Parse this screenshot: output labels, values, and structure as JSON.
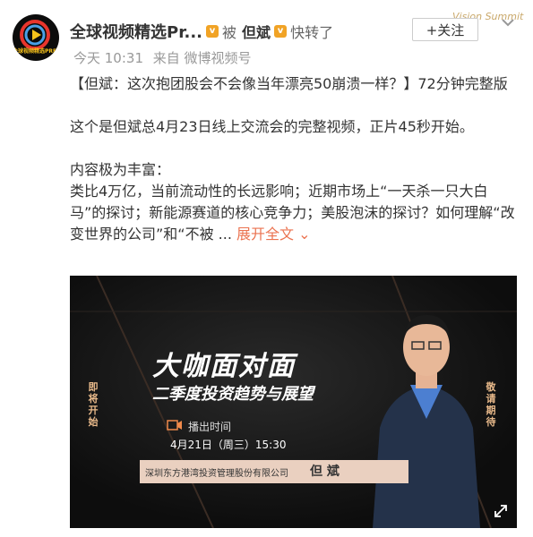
{
  "post": {
    "author": "全球视频精选Pr...",
    "forward_text": "被",
    "original_author": "但斌",
    "action": "快转了",
    "time": "今天 10:31",
    "source": "来自 微博视频号",
    "follow_label": "+关注",
    "watermark": "Vision Summit",
    "avatar_text": "全球视频精选PREMIUM"
  },
  "content": {
    "line1": "【但斌：这次抱团股会不会像当年漂亮50崩溃一样？】72分钟完整版",
    "line2": "这个是但斌总4月23日线上交流会的完整视频，正片45秒开始。",
    "line3": "内容极为丰富：",
    "line4": "类比4万亿，当前流动性的长远影响；近期市场上“一天杀一只大白马”的探讨；新能源赛道的核心竞争力；美股泡沫的探讨？如何理解“改变世界的公司”和“不被 ...",
    "expand": "展开全文"
  },
  "video": {
    "title": "大咖面对面",
    "subtitle": "二季度投资趋势与展望",
    "left_vertical": "即将开始",
    "right_vertical": "敬请期待",
    "play_label": "播出时间",
    "date": "4月21日（周三）15:30",
    "company": "深圳东方港湾投资管理股份有限公司",
    "speaker": "但 斌"
  },
  "colors": {
    "badge": "#f1a325",
    "accent": "#eb7350",
    "video_bg": "#151515",
    "bar": "#ead0c0"
  },
  "icons": [
    "chevron-down-icon",
    "camera-icon",
    "fullscreen-icon",
    "vip-badge-icon"
  ]
}
